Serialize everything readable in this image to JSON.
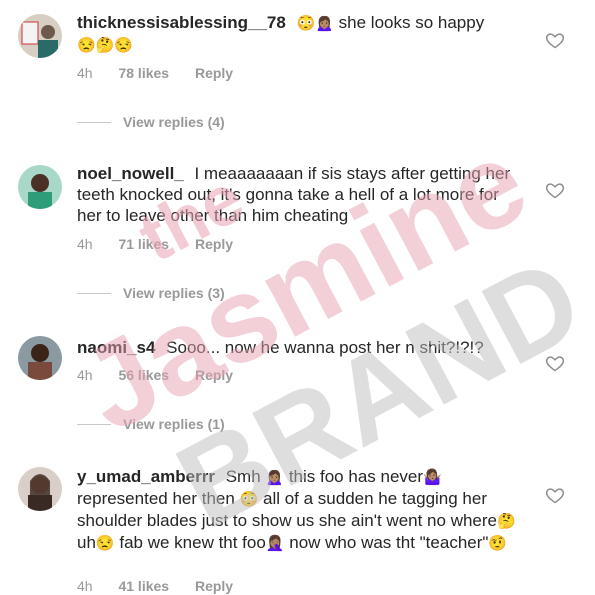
{
  "comments": [
    {
      "username": "thicknessisablessing__78",
      "emoji_lead": "😳🙍🏽‍♀️",
      "text": "she looks so happy",
      "text2": "",
      "emoji_tail": "😒🤔😒",
      "time": "4h",
      "likes": "78 likes",
      "reply": "Reply",
      "avatar_icon": "woman-with-poster-avatar",
      "avatar_color": "#6e5a4a"
    },
    {
      "username": "noel_nowell_",
      "text": "I meaaaaaaan if sis stays after getting her teeth knocked out, it's gonna take a hell of a lot more for her to leave other than him cheating",
      "time": "4h",
      "likes": "71 likes",
      "reply": "Reply",
      "avatar_icon": "woman-avatar",
      "avatar_color": "#2e9c78"
    },
    {
      "username": "naomi_s4",
      "text": "Sooo... now he wanna post her n shit?!?!?",
      "time": "4h",
      "likes": "56 likes",
      "reply": "Reply",
      "avatar_icon": "woman-avatar",
      "avatar_color": "#7a4a3c"
    },
    {
      "username": "y_umad_amberrr",
      "text_a": "Smh",
      "text_b": "this foo has never",
      "text_c": "represented her then",
      "text_d": "all of a sudden he tagging her shoulder blades just to show us she ain't went no where",
      "text_e": "uh",
      "text_f": "fab we knew tht foo",
      "text_g": "now who was tht \"teacher\"",
      "emoji_1": "🙍🏽‍♀️",
      "emoji_2": "🤷🏽‍♀️",
      "emoji_3": "😳",
      "emoji_4": "🤔",
      "emoji_5": "😒",
      "emoji_6": "🤦🏽‍♀️",
      "emoji_7": "🤨",
      "time": "4h",
      "likes": "41 likes",
      "reply": "Reply",
      "avatar_icon": "woman-avatar",
      "avatar_color": "#3a2a24"
    }
  ],
  "view_replies": [
    "View replies (4)",
    "View replies (3)",
    "View replies (1)"
  ],
  "watermark": {
    "line1": "the",
    "line2": "Jasmine",
    "line3": "BRAND",
    "color1": "#e8a0b0",
    "color2": "#bdbdbd"
  },
  "colors": {
    "text": "#262626",
    "meta": "#999999",
    "heart": "#8e8e8e"
  }
}
